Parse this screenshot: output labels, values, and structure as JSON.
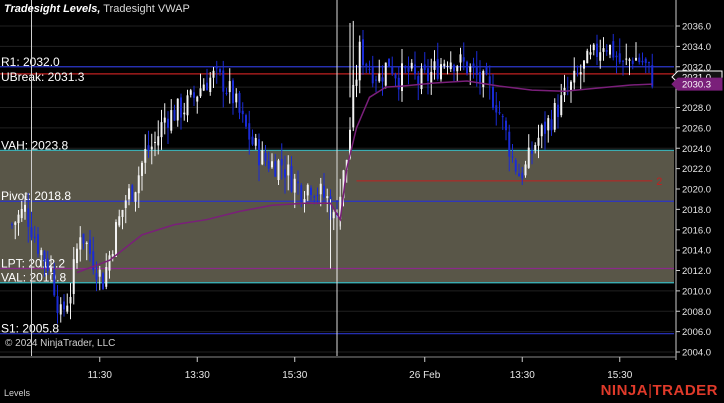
{
  "title": {
    "indicator": "Tradesight Levels,",
    "secondary": "Tradesight VWAP"
  },
  "copyright": "© 2024 NinjaTrader, LLC",
  "bottom_panel_label": "Levels",
  "brand": {
    "left": "NINJA",
    "right": "TRADER"
  },
  "colors": {
    "background": "#000000",
    "candle_up": "#f2f2f2",
    "candle_down": "#1a2bd6",
    "vwap": "#7a1f7a",
    "value_area_fill": "#595648",
    "value_area_line": "#39b8c0",
    "level_blue": "#2a35c8",
    "level_red": "#c02020",
    "level_purple": "#8a2a8a",
    "axis_text": "#e6e6e6",
    "grid": "#202020"
  },
  "chart_data": {
    "type": "candlestick",
    "y_axis": {
      "range": [
        2004,
        2037.6
      ],
      "ticks": [
        "2004.0",
        "2006.0",
        "2008.0",
        "2010.0",
        "2012.0",
        "2014.0",
        "2016.0",
        "2018.0",
        "2020.0",
        "2022.0",
        "2024.0",
        "2026.0",
        "2028.0",
        "2030.0",
        "2032.0",
        "2034.0",
        "2036.0"
      ]
    },
    "x_axis": {
      "ticks": [
        {
          "label": "11:30",
          "bar": 27
        },
        {
          "label": "13:30",
          "bar": 57
        },
        {
          "label": "15:30",
          "bar": 87
        },
        {
          "label": "26 Feb",
          "bar": 127
        },
        {
          "label": "13:30",
          "bar": 157
        },
        {
          "label": "15:30",
          "bar": 187
        }
      ]
    },
    "session_break_bar": 100,
    "value_area": {
      "high": 2023.8,
      "low": 2010.8
    },
    "levels": [
      {
        "label": "R1: 2032.0",
        "value": 2032.0,
        "color": "#2a35c8"
      },
      {
        "label": "UBreak: 2031.3",
        "value": 2031.3,
        "color": "#c02020"
      },
      {
        "label": "VAH: 2023.8",
        "value": 2023.8,
        "color": "#39b8c0"
      },
      {
        "label": "Pivot: 2018.8",
        "value": 2018.8,
        "color": "#2a35c8"
      },
      {
        "label": "LPT: 2012.2",
        "value": 2012.2,
        "color": "#8a2a8a"
      },
      {
        "label": "VAL: 2010.8",
        "value": 2010.8,
        "color": "#39b8c0"
      },
      {
        "label": "S1: 2005.8",
        "value": 2005.8,
        "color": "#2a35c8"
      }
    ],
    "extra_line": {
      "value": 2020.8,
      "from_bar": 106,
      "to_bar": 197,
      "marker": "2"
    },
    "price_markers": [
      {
        "label": "2031.0",
        "value": 2031.0,
        "style": "current"
      },
      {
        "label": "2030.3",
        "value": 2030.3,
        "style": "vwap"
      }
    ],
    "close_path": [
      [
        0,
        2016.5
      ],
      [
        4,
        2018.0
      ],
      [
        8,
        2014.5
      ],
      [
        12,
        2012.0
      ],
      [
        15,
        2007.5
      ],
      [
        18,
        2010.0
      ],
      [
        21,
        2016.0
      ],
      [
        25,
        2013.0
      ],
      [
        28,
        2011.0
      ],
      [
        32,
        2016.0
      ],
      [
        35,
        2019.0
      ],
      [
        38,
        2020.5
      ],
      [
        41,
        2023.5
      ],
      [
        44,
        2024.5
      ],
      [
        47,
        2027.0
      ],
      [
        50,
        2027.5
      ],
      [
        53,
        2028.0
      ],
      [
        56,
        2029.0
      ],
      [
        59,
        2030.5
      ],
      [
        62,
        2031.0
      ],
      [
        65,
        2030.5
      ],
      [
        68,
        2029.0
      ],
      [
        71,
        2026.5
      ],
      [
        74,
        2024.5
      ],
      [
        77,
        2023.0
      ],
      [
        80,
        2022.5
      ],
      [
        83,
        2022.5
      ],
      [
        86,
        2021.0
      ],
      [
        89,
        2020.0
      ],
      [
        92,
        2020.5
      ],
      [
        95,
        2019.5
      ],
      [
        97,
        2019.0
      ],
      [
        99,
        2017.0
      ],
      [
        101,
        2019.5
      ],
      [
        103,
        2023.0
      ],
      [
        105,
        2029.0
      ],
      [
        107,
        2033.5
      ],
      [
        110,
        2032.0
      ],
      [
        113,
        2031.0
      ],
      [
        116,
        2032.5
      ],
      [
        119,
        2031.0
      ],
      [
        122,
        2031.5
      ],
      [
        125,
        2030.5
      ],
      [
        128,
        2031.0
      ],
      [
        131,
        2032.0
      ],
      [
        134,
        2033.0
      ],
      [
        137,
        2032.5
      ],
      [
        140,
        2032.0
      ],
      [
        143,
        2031.0
      ],
      [
        146,
        2030.0
      ],
      [
        149,
        2028.5
      ],
      [
        151,
        2026.5
      ],
      [
        154,
        2023.0
      ],
      [
        156,
        2021.5
      ],
      [
        158,
        2022.0
      ],
      [
        161,
        2024.5
      ],
      [
        164,
        2026.0
      ],
      [
        167,
        2027.5
      ],
      [
        170,
        2029.0
      ],
      [
        173,
        2030.5
      ],
      [
        176,
        2032.0
      ],
      [
        179,
        2033.0
      ],
      [
        182,
        2034.5
      ],
      [
        185,
        2033.5
      ],
      [
        188,
        2032.0
      ],
      [
        191,
        2033.0
      ],
      [
        194,
        2032.5
      ],
      [
        196,
        2031.5
      ],
      [
        197,
        2031.0
      ]
    ],
    "vwap_points": [
      [
        20,
        2011.8
      ],
      [
        30,
        2013.0
      ],
      [
        40,
        2015.5
      ],
      [
        50,
        2016.5
      ],
      [
        60,
        2017.0
      ],
      [
        70,
        2017.8
      ],
      [
        80,
        2018.4
      ],
      [
        90,
        2018.6
      ],
      [
        98,
        2018.6
      ],
      [
        101,
        2017.0
      ],
      [
        103,
        2022.0
      ],
      [
        106,
        2026.0
      ],
      [
        110,
        2029.0
      ],
      [
        115,
        2030.0
      ],
      [
        120,
        2030.1
      ],
      [
        130,
        2030.4
      ],
      [
        140,
        2030.6
      ],
      [
        150,
        2030.1
      ],
      [
        160,
        2029.7
      ],
      [
        170,
        2029.6
      ],
      [
        180,
        2029.9
      ],
      [
        190,
        2030.2
      ],
      [
        197,
        2030.3
      ]
    ]
  }
}
